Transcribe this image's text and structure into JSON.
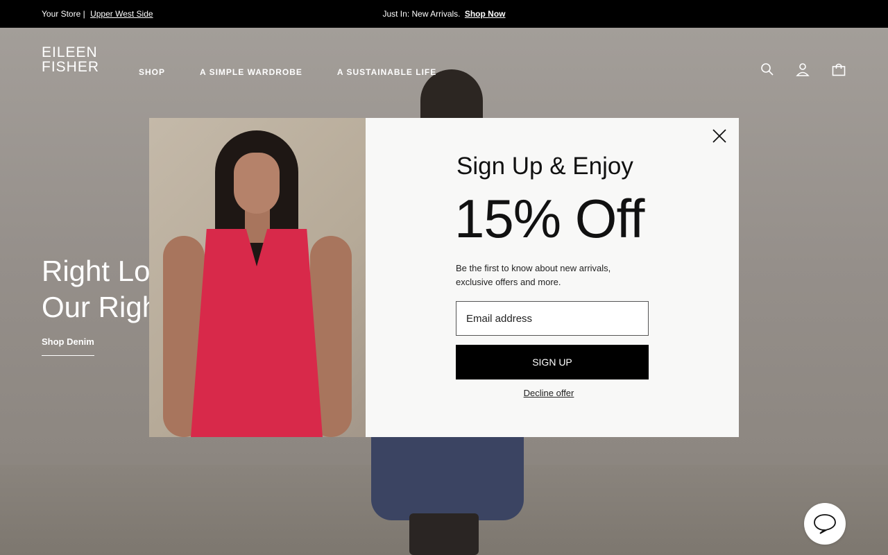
{
  "topbar": {
    "store_prefix": "Your Store |",
    "store_link": "Upper West Side",
    "promo_text": "Just In: New Arrivals.",
    "promo_link": "Shop Now"
  },
  "header": {
    "logo_line1": "EILEEN",
    "logo_line2": "FISHER",
    "nav": [
      "SHOP",
      "A SIMPLE WARDROBE",
      "A SUSTAINABLE LIFE"
    ],
    "icons": [
      "search-icon",
      "account-icon",
      "bag-icon"
    ]
  },
  "hero": {
    "title_line1": "Right Lo",
    "title_line2": "Our Righ",
    "link": "Shop Denim"
  },
  "modal": {
    "heading": "Sign Up & Enjoy",
    "offer": "15% Off",
    "description": "Be the first to know about new arrivals, exclusive offers and more.",
    "email_placeholder": "Email address",
    "signup_label": "SIGN UP",
    "decline_label": "Decline offer"
  },
  "colors": {
    "topbar_bg": "#000000",
    "accent_dress": "#d8294a",
    "button_bg": "#000000"
  }
}
